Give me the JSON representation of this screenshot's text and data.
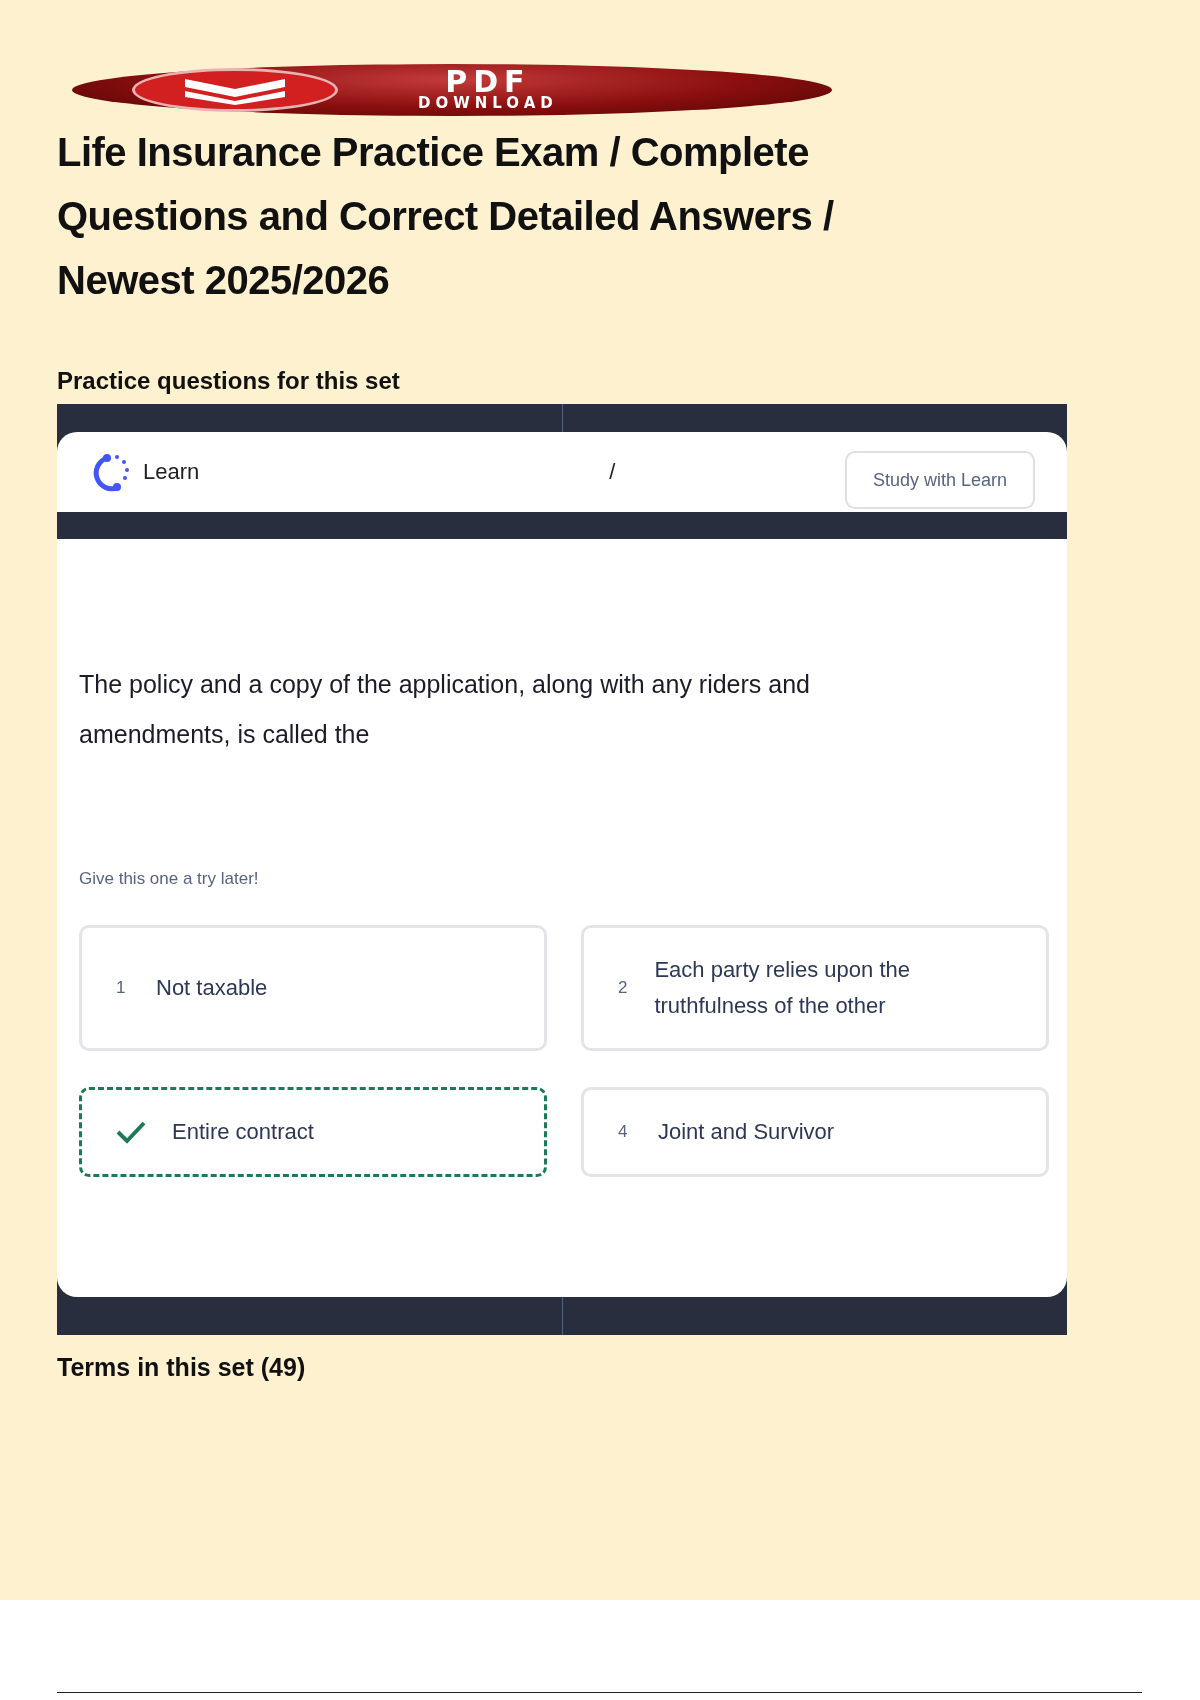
{
  "banner": {
    "line_1": "PDF",
    "line_2": "DOWNLOAD"
  },
  "title": "Life Insurance Practice Exam / Complete Questions and Correct Detailed Answers / Newest 2025/2026",
  "section_heading": "Practice questions for this set",
  "learn_card": {
    "mode_label": "Learn",
    "separator": "/",
    "study_button": "Study with Learn",
    "question": "The policy and a copy of the application, along with any riders and amendments, is called the",
    "hint": "Give this one a try later!",
    "options": [
      {
        "number": "1",
        "text": "Not taxable",
        "correct": false
      },
      {
        "number": "2",
        "text": "Each party relies upon the truthfulness of the other",
        "correct": false
      },
      {
        "text": "Entire contract",
        "correct": true
      },
      {
        "number": "4",
        "text": "Joint and Survivor",
        "correct": false
      }
    ]
  },
  "terms_heading": "Terms in this set (49)"
}
